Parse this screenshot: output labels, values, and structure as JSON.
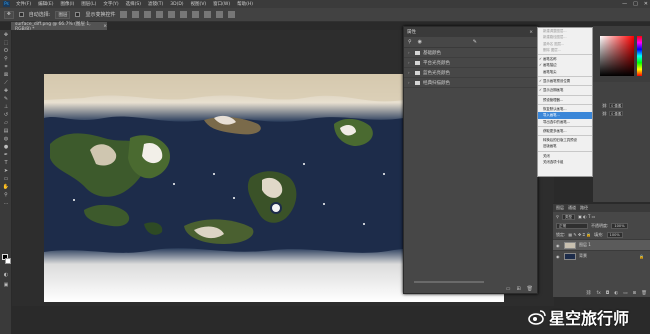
{
  "menubar": {
    "items": [
      "文件(F)",
      "编辑(E)",
      "图像(I)",
      "图层(L)",
      "文字(Y)",
      "选择(S)",
      "滤镜(T)",
      "3D(D)",
      "视图(V)",
      "窗口(W)",
      "帮助(H)"
    ],
    "window_controls": [
      "—",
      "□",
      "✕"
    ]
  },
  "options": {
    "auto_select_label": "自动选择:",
    "auto_select_value": "图层",
    "show_transform_label": "显示变换控件"
  },
  "document": {
    "tab_title": "surface_diff.png @ 66.7% (图层 1, RGB/8) *",
    "close": "×"
  },
  "paths_panel": {
    "title": "属性",
    "items": [
      {
        "label": "基础颜色"
      },
      {
        "label": "平台光亮颜色"
      },
      {
        "label": "蓝色光亮颜色"
      },
      {
        "label": "经典扫描颜色"
      }
    ],
    "footer_icons": [
      "folder-icon",
      "new-icon",
      "trash-icon"
    ]
  },
  "context_menu": {
    "items": [
      {
        "label": "新建调整图层...",
        "state": "dis"
      },
      {
        "label": "新建路径图层...",
        "state": "dis"
      },
      {
        "label": "重命名 图层...",
        "state": "dis"
      },
      {
        "label": "删除 图层...",
        "state": "dis"
      },
      {
        "sep": true
      },
      {
        "label": "画笔名称",
        "state": "chk"
      },
      {
        "label": "画笔描边",
        "state": "chk"
      },
      {
        "label": "画笔笔尖",
        "state": ""
      },
      {
        "sep": true
      },
      {
        "label": "显示画笔预设位置",
        "state": "chk"
      },
      {
        "sep": true
      },
      {
        "label": "显示近期画笔",
        "state": "chk"
      },
      {
        "sep": true
      },
      {
        "label": "预设管理器...",
        "state": ""
      },
      {
        "sep": true
      },
      {
        "label": "恢复默认画笔...",
        "state": ""
      },
      {
        "label": "导入画笔...",
        "state": "hl"
      },
      {
        "label": "导出选中的画笔...",
        "state": ""
      },
      {
        "sep": true
      },
      {
        "label": "获取更多画笔...",
        "state": ""
      },
      {
        "sep": true
      },
      {
        "label": "转换后的旧版工具预设",
        "state": ""
      },
      {
        "label": "旧版画笔",
        "state": ""
      },
      {
        "sep": true
      },
      {
        "label": "关闭",
        "state": ""
      },
      {
        "label": "关闭选项卡组",
        "state": ""
      }
    ]
  },
  "properties": {
    "w_value": "0 像素",
    "h_value": "0 像素"
  },
  "layers_panel": {
    "tabs": [
      "图层",
      "通道",
      "路径"
    ],
    "kind_label": "类型",
    "blend_mode": "正常",
    "opacity_label": "不透明度:",
    "opacity_value": "100%",
    "lock_label": "锁定:",
    "fill_label": "填充:",
    "fill_value": "100%",
    "layers": [
      {
        "name": "图层 1",
        "selected": true
      },
      {
        "name": "背景",
        "selected": false
      }
    ]
  },
  "watermark": {
    "text": "星空旅行师"
  },
  "colors": {
    "ocean": "#1d2c4a",
    "highlight": "#3a86d8",
    "menu_bg": "#f0f0f0"
  }
}
